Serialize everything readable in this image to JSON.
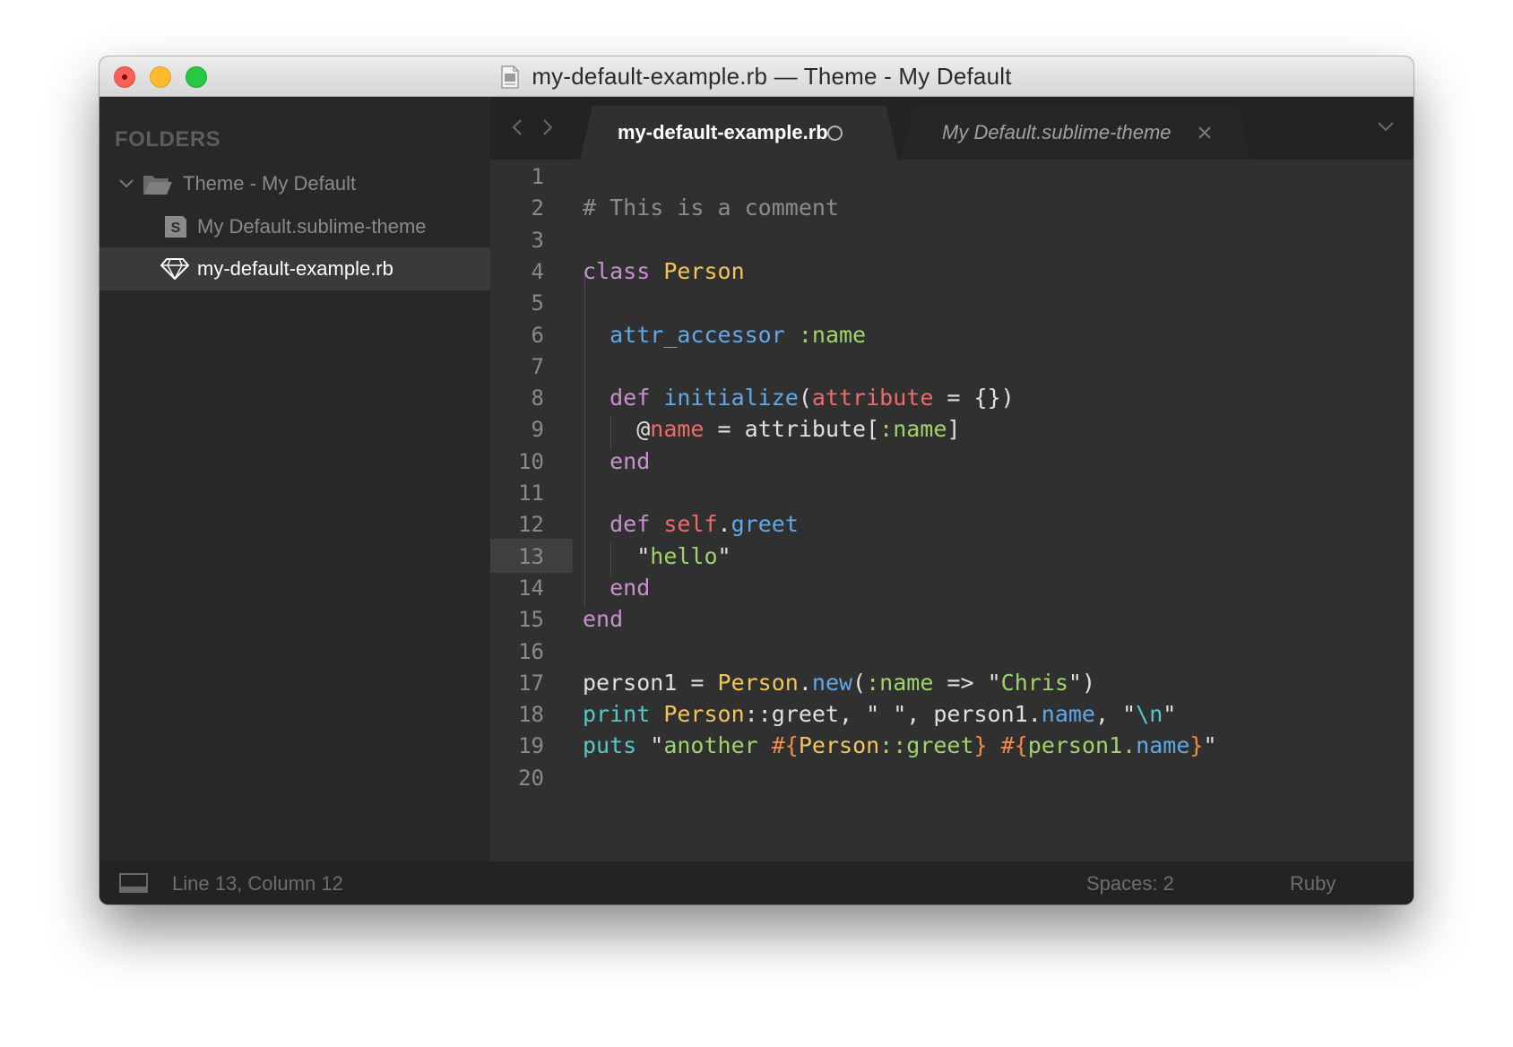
{
  "window": {
    "title": "my-default-example.rb — Theme - My Default"
  },
  "sidebar": {
    "heading": "FOLDERS",
    "root_folder": "Theme - My Default",
    "files": [
      {
        "label": "My Default.sublime-theme",
        "icon": "sublime-s-icon"
      },
      {
        "label": "my-default-example.rb",
        "icon": "ruby-gem-icon",
        "selected": true
      }
    ]
  },
  "tabs": [
    {
      "label": "my-default-example.rb",
      "active": true,
      "dirty": true
    },
    {
      "label": "My Default.sublime-theme",
      "active": false,
      "preview": true
    }
  ],
  "editor": {
    "current_line": 13,
    "line_numbers": [
      "1",
      "2",
      "3",
      "4",
      "5",
      "6",
      "7",
      "8",
      "9",
      "10",
      "11",
      "12",
      "13",
      "14",
      "15",
      "16",
      "17",
      "18",
      "19",
      "20"
    ],
    "lines": [
      [],
      [
        {
          "t": "# This is a comment",
          "c": "com"
        }
      ],
      [],
      [
        {
          "t": "class ",
          "c": "kw"
        },
        {
          "t": "Person",
          "c": "cls"
        }
      ],
      [],
      [
        {
          "t": "  ",
          "c": "plain"
        },
        {
          "t": "attr_accessor",
          "c": "fn"
        },
        {
          "t": " ",
          "c": "plain"
        },
        {
          "t": ":name",
          "c": "sym"
        }
      ],
      [],
      [
        {
          "t": "  ",
          "c": "plain"
        },
        {
          "t": "def ",
          "c": "kw"
        },
        {
          "t": "initialize",
          "c": "fn"
        },
        {
          "t": "(",
          "c": "plain"
        },
        {
          "t": "attribute",
          "c": "arg"
        },
        {
          "t": " = {})",
          "c": "plain"
        }
      ],
      [
        {
          "t": "    @",
          "c": "plain"
        },
        {
          "t": "name",
          "c": "arg"
        },
        {
          "t": " = attribute[",
          "c": "plain"
        },
        {
          "t": ":name",
          "c": "sym"
        },
        {
          "t": "]",
          "c": "plain"
        }
      ],
      [
        {
          "t": "  ",
          "c": "plain"
        },
        {
          "t": "end",
          "c": "kw"
        }
      ],
      [],
      [
        {
          "t": "  ",
          "c": "plain"
        },
        {
          "t": "def ",
          "c": "kw"
        },
        {
          "t": "self",
          "c": "arg"
        },
        {
          "t": ".",
          "c": "plain"
        },
        {
          "t": "greet",
          "c": "fn"
        }
      ],
      [
        {
          "t": "    \"",
          "c": "plain"
        },
        {
          "t": "hello",
          "c": "str"
        },
        {
          "t": "\"",
          "c": "plain"
        }
      ],
      [
        {
          "t": "  ",
          "c": "plain"
        },
        {
          "t": "end",
          "c": "kw"
        }
      ],
      [
        {
          "t": "end",
          "c": "kw"
        }
      ],
      [],
      [
        {
          "t": "person1 = ",
          "c": "plain"
        },
        {
          "t": "Person",
          "c": "cls"
        },
        {
          "t": ".",
          "c": "plain"
        },
        {
          "t": "new",
          "c": "fn"
        },
        {
          "t": "(",
          "c": "plain"
        },
        {
          "t": ":name",
          "c": "sym"
        },
        {
          "t": " => \"",
          "c": "plain"
        },
        {
          "t": "Chris",
          "c": "str"
        },
        {
          "t": "\")",
          "c": "plain"
        }
      ],
      [
        {
          "t": "print ",
          "c": "builtin"
        },
        {
          "t": "Person",
          "c": "cls"
        },
        {
          "t": "::greet, \" \", person1.",
          "c": "plain"
        },
        {
          "t": "name",
          "c": "fn"
        },
        {
          "t": ", \"",
          "c": "plain"
        },
        {
          "t": "\\n",
          "c": "esc"
        },
        {
          "t": "\"",
          "c": "plain"
        }
      ],
      [
        {
          "t": "puts ",
          "c": "builtin"
        },
        {
          "t": "\"",
          "c": "plain"
        },
        {
          "t": "another ",
          "c": "str"
        },
        {
          "t": "#{",
          "c": "interp"
        },
        {
          "t": "Person",
          "c": "cls"
        },
        {
          "t": "::greet",
          "c": "str"
        },
        {
          "t": "}",
          "c": "interp"
        },
        {
          "t": " ",
          "c": "str"
        },
        {
          "t": "#{",
          "c": "interp"
        },
        {
          "t": "person1.",
          "c": "str"
        },
        {
          "t": "name",
          "c": "fn"
        },
        {
          "t": "}",
          "c": "interp"
        },
        {
          "t": "\"",
          "c": "plain"
        }
      ],
      []
    ]
  },
  "statusbar": {
    "position": "Line 13, Column 12",
    "indentation": "Spaces: 2",
    "syntax": "Ruby"
  },
  "colors": {
    "traffic_close": "#fc5f57",
    "traffic_minimize": "#fdbc2e",
    "traffic_maximize": "#28c840",
    "editor_bg": "#303030",
    "sidebar_bg": "#282828"
  }
}
